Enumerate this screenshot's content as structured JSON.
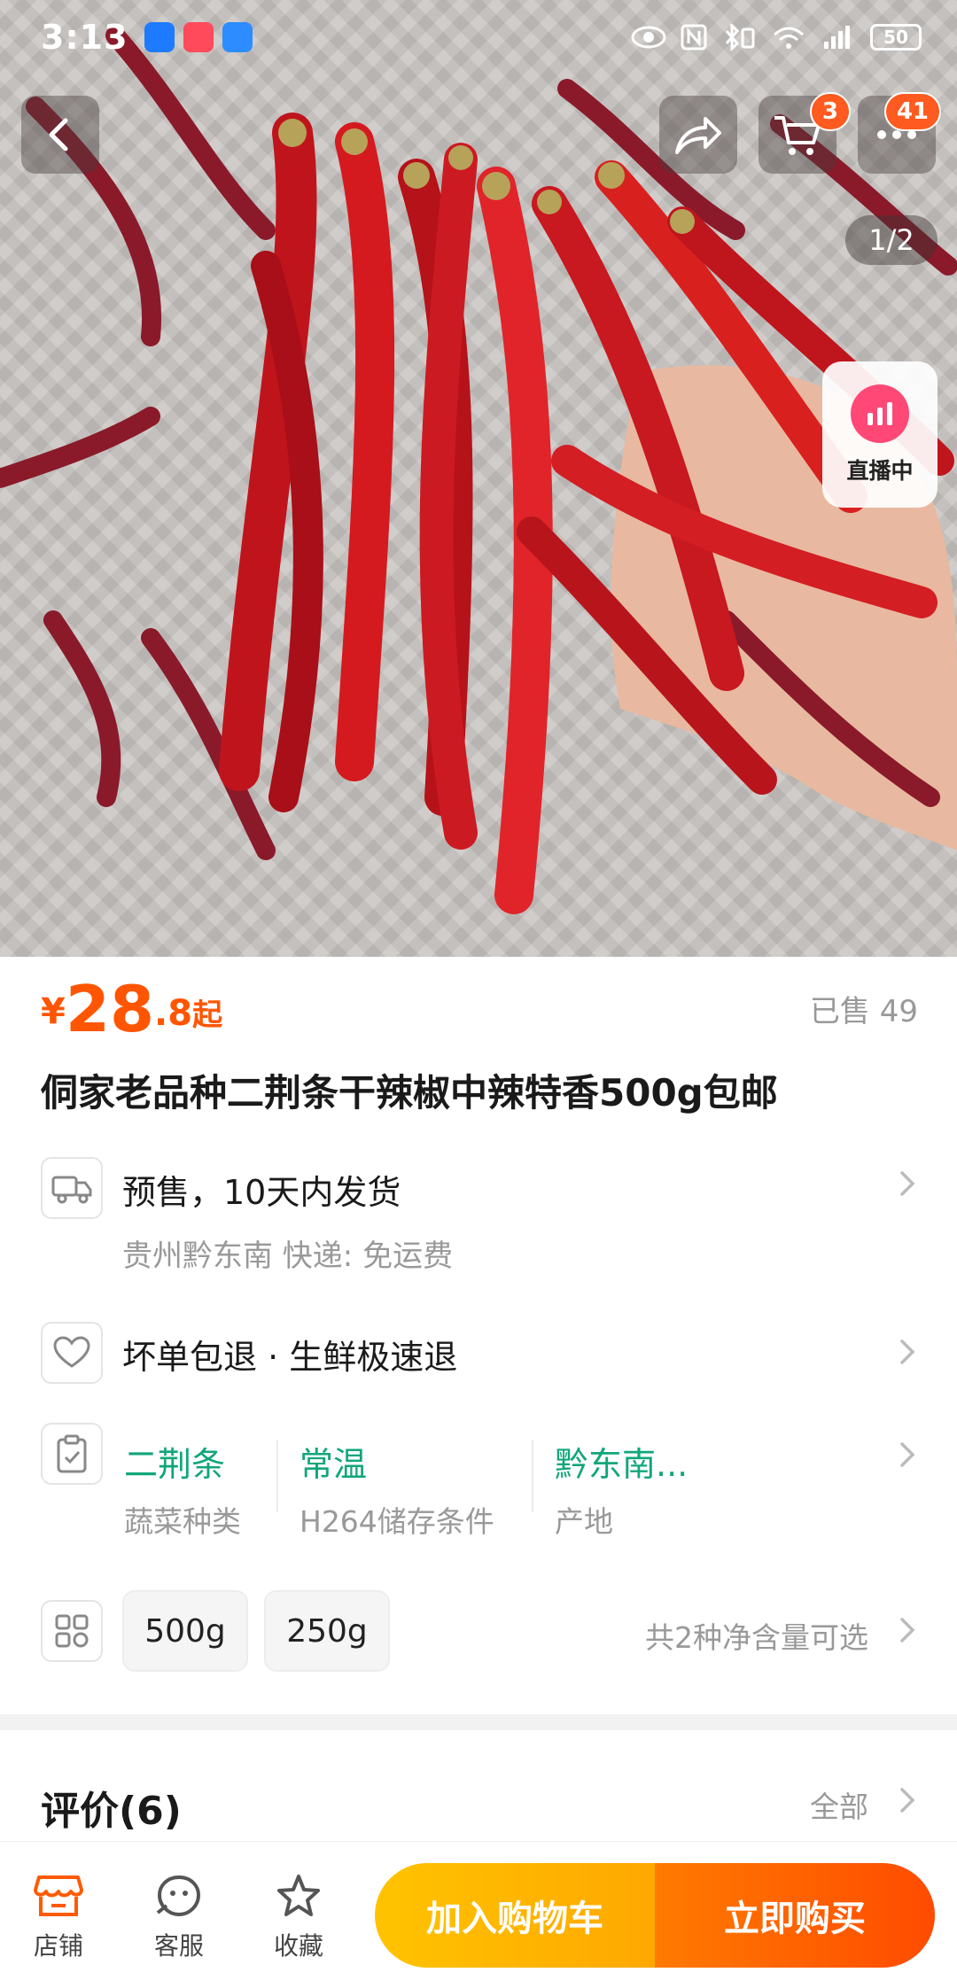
{
  "status_bar": {
    "time": "3:13",
    "battery": "50",
    "network": "4G"
  },
  "gallery": {
    "counter": "1/2",
    "live_label": "直播中"
  },
  "top_bar": {
    "cart_badge": "3",
    "message_badge": "41"
  },
  "product": {
    "currency": "¥",
    "price_int": "28",
    "price_dec": ".8",
    "price_suffix": "起",
    "sold": "已售 49",
    "title": "侗家老品种二荆条干辣椒中辣特香500g包邮"
  },
  "shipping": {
    "main": "预售，10天内发货",
    "sub": "贵州黔东南  快递: 免运费"
  },
  "guarantee": {
    "main": "坏单包退 · 生鲜极速退"
  },
  "attributes": [
    {
      "value": "二荆条",
      "key": "蔬菜种类"
    },
    {
      "value": "常温",
      "key": "H264储存条件"
    },
    {
      "value": "黔东南...",
      "key": "产地"
    }
  ],
  "specs": {
    "options": [
      "500g",
      "250g"
    ],
    "summary": "共2种净含量可选"
  },
  "reviews": {
    "title": "评价(6)",
    "all": "全部"
  },
  "bottom_bar": {
    "store": "店铺",
    "service": "客服",
    "favorite": "收藏",
    "add_to_cart": "加入购物车",
    "buy_now": "立即购买"
  },
  "colors": {
    "accent": "#ff5500",
    "attr_green": "#11a67a",
    "cart_yellow": "#ffb800",
    "buy_orange": "#ff5a00"
  }
}
